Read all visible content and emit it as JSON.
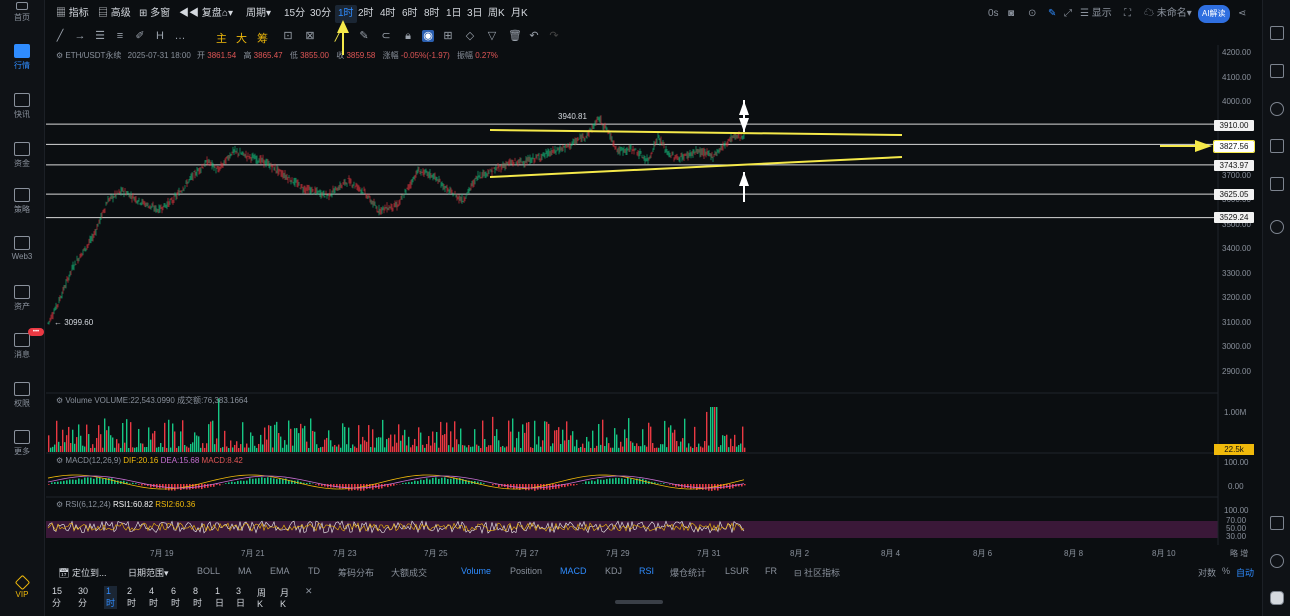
{
  "left_nav": [
    {
      "label": "首页",
      "icon": "home-icon"
    },
    {
      "label": "行情",
      "icon": "market-icon",
      "active": true
    },
    {
      "label": "快讯",
      "icon": "news-icon"
    },
    {
      "label": "资金",
      "icon": "funds-icon"
    },
    {
      "label": "策略",
      "icon": "strategy-icon"
    },
    {
      "label": "Web3",
      "icon": "web3-icon"
    },
    {
      "label": "资产",
      "icon": "assets-icon"
    },
    {
      "label": "消息",
      "icon": "message-icon"
    },
    {
      "label": "权限",
      "icon": "permission-icon"
    },
    {
      "label": "更多",
      "icon": "more-icon"
    },
    {
      "label": "VIP",
      "icon": "vip-icon"
    }
  ],
  "nav_badge": "•••",
  "toolbar": {
    "indicators": "指标",
    "advanced": "高级",
    "multi": "多窗",
    "replay": "复盘",
    "period": "周期",
    "intervals": [
      "15分",
      "30分",
      "1时",
      "2时",
      "4时",
      "6时",
      "8时",
      "1日",
      "3日",
      "周K",
      "月K"
    ],
    "selected_interval": "1时",
    "countdown": "0s",
    "display": "显示",
    "layout_name": "未命名",
    "ai_button": "AI解读"
  },
  "draw_labels": [
    "主",
    "大",
    "筹"
  ],
  "ohlc": {
    "symbol": "ETH/USDT永续",
    "datetime": "2025-07-31 18:00",
    "open_label": "开",
    "open": "3861.54",
    "high_label": "高",
    "high": "3865.47",
    "low_label": "低",
    "low": "3855.00",
    "close_label": "收",
    "close": "3859.58",
    "change_label": "涨幅",
    "change": "-0.05%(-1.97)",
    "amp_label": "振幅",
    "amp": "0.27%"
  },
  "price_axis": [
    "4200.00",
    "4100.00",
    "4000.00",
    "3900.00",
    "3800.00",
    "3700.00",
    "3600.00",
    "3500.00",
    "3400.00",
    "3300.00",
    "3200.00",
    "3100.00",
    "3000.00",
    "2900.00"
  ],
  "levels": [
    "3910.00",
    "3827.56",
    "3743.97",
    "3625.05",
    "3529.24"
  ],
  "current_level": "3827.56",
  "annotations": {
    "high": "3940.81",
    "low": "3099.60"
  },
  "volume": {
    "label": "Volume",
    "value": "VOLUME:22,543.0990",
    "amount_label": "成交额",
    "amount": "76,383.1664",
    "axis_top": "1.00M",
    "current": "22.5k"
  },
  "macd": {
    "label": "MACD(12,26,9)",
    "dif": "DIF:20.16",
    "dea": "DEA:15.68",
    "macd": "MACD:8.42",
    "axis": [
      "100.00",
      "0.00"
    ]
  },
  "rsi": {
    "label": "RSI(6,12,24)",
    "rsi1": "RSI1:60.82",
    "rsi2": "RSI2:60.36",
    "axis": [
      "100.00",
      "70.00",
      "50.00",
      "30.00"
    ]
  },
  "dates": [
    "7月 19",
    "7月 21",
    "7月 23",
    "7月 25",
    "7月 27",
    "7月 29",
    "7月 31",
    "8月 2",
    "8月 4",
    "8月 6",
    "8月 8",
    "8月 10"
  ],
  "date_right": "略 增",
  "bottom_bar": {
    "locate": "定位到...",
    "date_range": "日期范围",
    "main_indicators": [
      "BOLL",
      "MA",
      "EMA",
      "TD",
      "筹码分布",
      "大额成交"
    ],
    "sub_indicators": [
      "Volume",
      "Position",
      "MACD",
      "KDJ",
      "RSI",
      "爆仓统计",
      "LSUR",
      "FR"
    ],
    "community": "社区指标",
    "right": [
      "对数",
      "%",
      "自动"
    ]
  },
  "tf_bar": [
    "15分",
    "30分",
    "1时",
    "2时",
    "4时",
    "6时",
    "8时",
    "1日",
    "3日",
    "周K",
    "月K"
  ],
  "tf_selected": "1时",
  "colors": {
    "up": "#16c784",
    "down": "#ea3943",
    "trend": "#f5e94a",
    "arrow_yellow": "#f5e94a",
    "accent": "#2f8cff"
  }
}
